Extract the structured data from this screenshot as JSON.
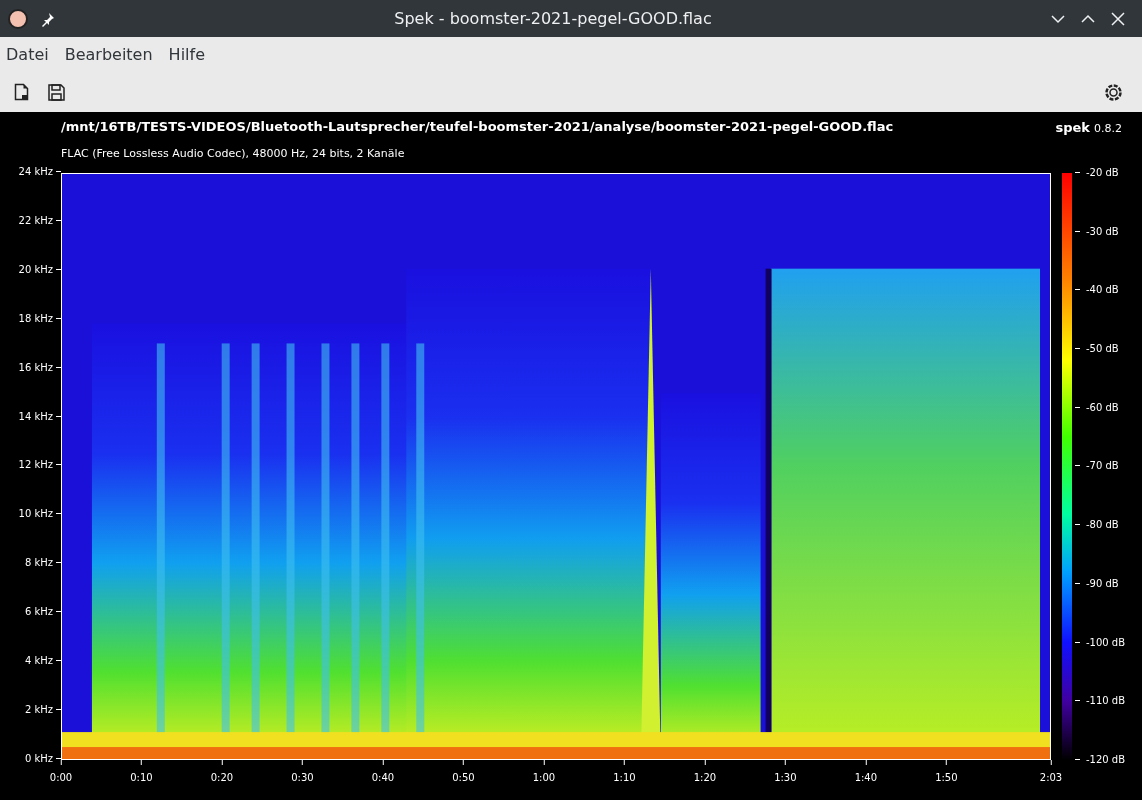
{
  "window": {
    "title": "Spek - boomster-2021-pegel-GOOD.flac"
  },
  "menu": [
    "Datei",
    "Bearbeiten",
    "Hilfe"
  ],
  "header": {
    "path": "/mnt/16TB/TESTS-VIDEOS/Bluetooth-Lautsprecher/teufel-boomster-2021/analyse/boomster-2021-pegel-GOOD.flac",
    "format": "FLAC (Free Lossless Audio Codec), 48000 Hz, 24 bits, 2 Kanäle",
    "app_name": "spek",
    "version": "0.8.2"
  },
  "spectrogram": {
    "kind": "picture",
    "y_axis": [
      "24 kHz",
      "22 kHz",
      "20 kHz",
      "18 kHz",
      "16 kHz",
      "14 kHz",
      "12 kHz",
      "10 kHz",
      "8 kHz",
      "6 kHz",
      "4 kHz",
      "2 kHz",
      "0 kHz"
    ],
    "x_axis": [
      "0:00",
      "0:10",
      "0:20",
      "0:30",
      "0:40",
      "0:50",
      "1:00",
      "1:10",
      "1:20",
      "1:30",
      "1:40",
      "1:50",
      "2:03"
    ]
  },
  "colorbar": {
    "labels": [
      "-20 dB",
      "-30 dB",
      "-40 dB",
      "-50 dB",
      "-60 dB",
      "-70 dB",
      "-80 dB",
      "-90 dB",
      "-100 dB",
      "-110 dB",
      "-120 dB"
    ]
  }
}
